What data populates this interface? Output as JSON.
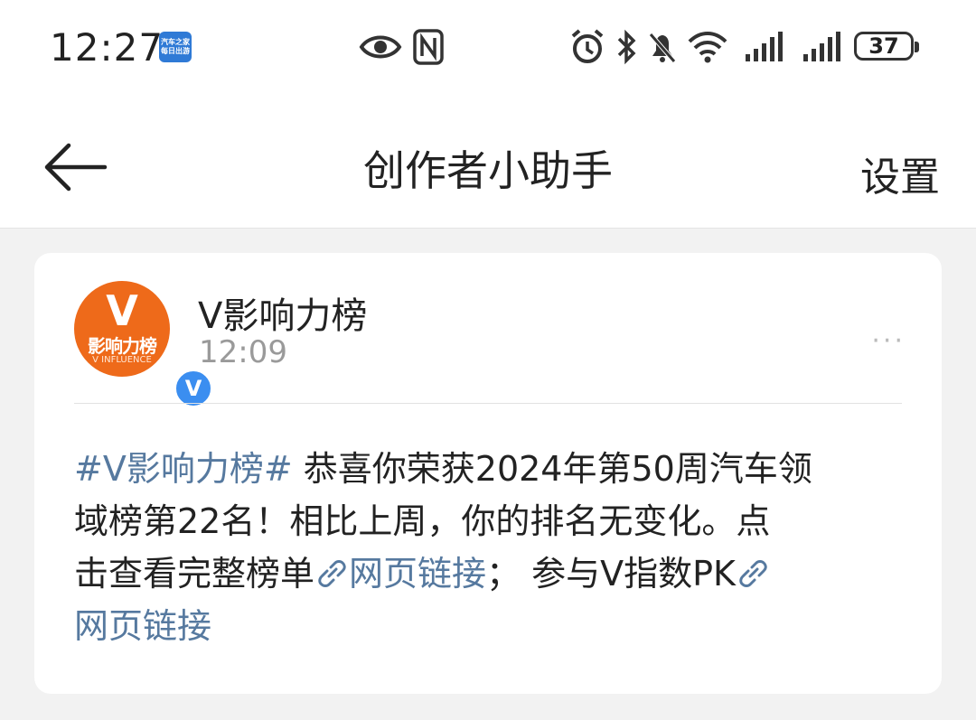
{
  "status_bar": {
    "time": "12:27",
    "app_icon_text_top": "汽车之家",
    "app_icon_text_bottom": "每日出游",
    "icons": [
      "eye-icon",
      "nfc-icon",
      "alarm-icon",
      "bluetooth-icon",
      "mute-icon",
      "wifi-icon",
      "signal-icon",
      "signal-icon"
    ],
    "battery": "37"
  },
  "nav": {
    "title": "创作者小助手",
    "settings": "设置"
  },
  "post": {
    "avatar_letter": "V",
    "avatar_text": "影响力榜",
    "avatar_sub": "V INFLUENCE",
    "verified_mark": "V",
    "author": "V影响力榜",
    "time": "12:09",
    "more": "···",
    "line1_topic": "#V影响力榜#",
    "line1_text": " 恭喜你荣获2024年第50周汽车领",
    "line2_text": "域榜第22名！相比上周，你的排名无变化。点",
    "line3_text": "击查看完整榜单",
    "link1_label": "网页链接",
    "line3_mid": "；  参与V指数PK",
    "link2_label": "网页链接"
  },
  "colors": {
    "link": "#56799f",
    "avatar_bg": "#ee6a1a",
    "verified": "#3b8ef0"
  }
}
